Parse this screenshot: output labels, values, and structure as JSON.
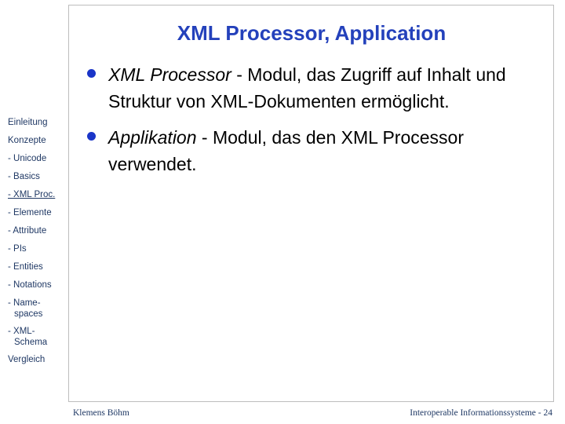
{
  "slide": {
    "title": "XML Processor, Application",
    "title_color": "#2441bb",
    "bullet_color": "#1a35c8",
    "frame_border_color": "#bdbdbd"
  },
  "body": {
    "bullets": [
      {
        "emphasis": "XML Processor",
        "rest": " - Modul, das Zugriff auf Inhalt und Struktur von XML-Dokumenten ermöglicht."
      },
      {
        "emphasis": "Applikation",
        "rest": " - Modul, das den XML Processor verwendet."
      }
    ]
  },
  "sidebar": {
    "items": [
      {
        "label": "Einleitung",
        "current": false,
        "wrapped": false
      },
      {
        "label": "Konzepte",
        "current": false,
        "wrapped": false
      },
      {
        "label": "- Unicode",
        "current": false,
        "wrapped": false
      },
      {
        "label": "- Basics",
        "current": false,
        "wrapped": false
      },
      {
        "label": "- XML Proc.",
        "current": true,
        "wrapped": false
      },
      {
        "label": "- Elemente",
        "current": false,
        "wrapped": false
      },
      {
        "label": "- Attribute",
        "current": false,
        "wrapped": false
      },
      {
        "label": "- PIs",
        "current": false,
        "wrapped": false
      },
      {
        "label": "- Entities",
        "current": false,
        "wrapped": false
      },
      {
        "label": "- Notations",
        "current": false,
        "wrapped": false
      },
      {
        "label": "- Name-",
        "label_cont": "spaces",
        "current": false,
        "wrapped": true
      },
      {
        "label": "- XML-",
        "label_cont": "Schema",
        "current": false,
        "wrapped": true
      },
      {
        "label": "Vergleich",
        "current": false,
        "wrapped": false
      }
    ]
  },
  "footer": {
    "author": "Klemens Böhm",
    "course_and_page": "Interoperable Informationssysteme - 24"
  }
}
